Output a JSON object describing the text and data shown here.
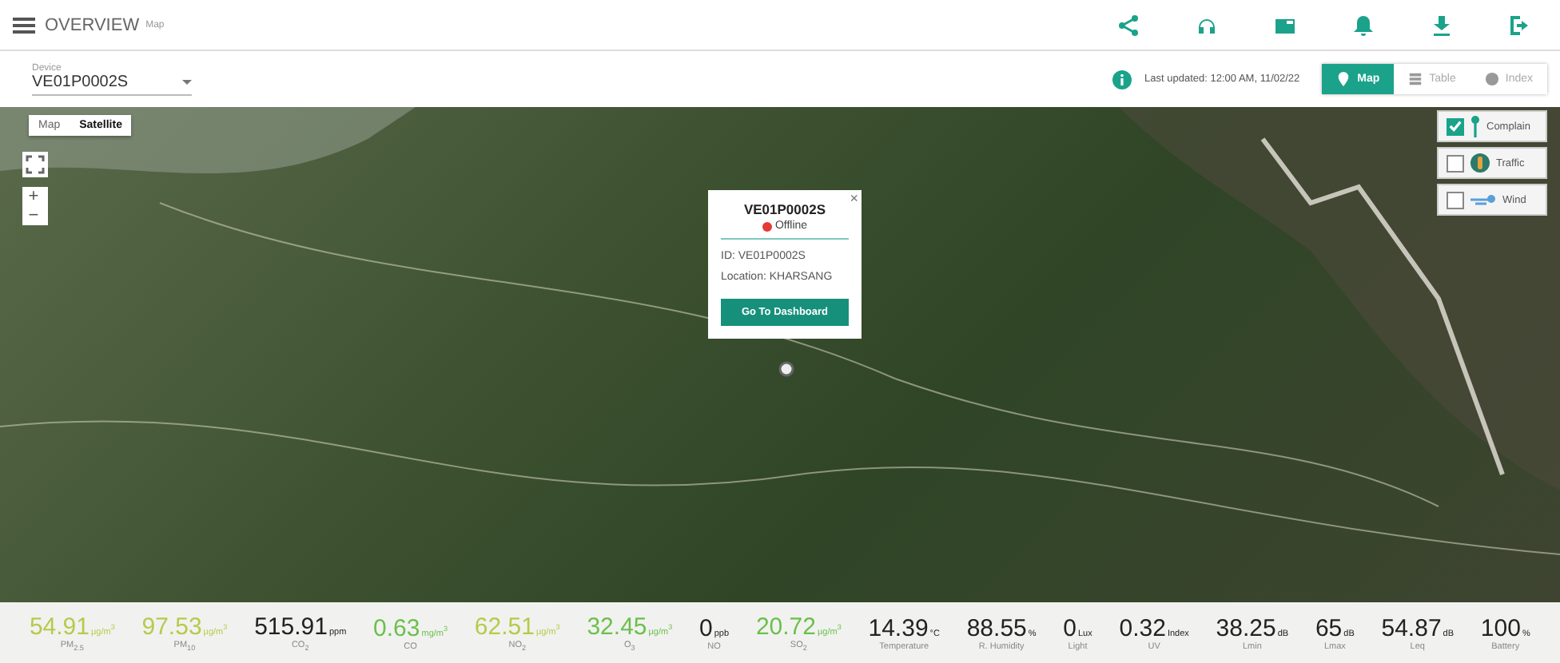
{
  "header": {
    "title": "OVERVIEW",
    "subtitle": "Map"
  },
  "device": {
    "label": "Device",
    "value": "VE01P0002S"
  },
  "status": {
    "last_updated": "Last updated: 12:00 AM, 11/02/22"
  },
  "views": [
    {
      "label": "Map",
      "selected": true
    },
    {
      "label": "Table",
      "selected": false
    },
    {
      "label": "Index",
      "selected": false
    }
  ],
  "map_types": [
    {
      "label": "Map",
      "selected": false
    },
    {
      "label": "Satellite",
      "selected": true
    }
  ],
  "zoom": {
    "in": "+",
    "out": "−"
  },
  "layers": [
    {
      "label": "Complain",
      "checked": true
    },
    {
      "label": "Traffic",
      "checked": false
    },
    {
      "label": "Wind",
      "checked": false
    }
  ],
  "popup": {
    "title": "VE01P0002S",
    "status": "Offline",
    "id": "ID: VE01P0002S",
    "location": "Location: KHARSANG",
    "button": "Go To Dashboard",
    "close": "×"
  },
  "readings": [
    {
      "value": "54.91",
      "unit": "µg/m$^{3}$",
      "label": "PM$_{2.5}$",
      "color": "#b8c94c"
    },
    {
      "value": "97.53",
      "unit": "µg/m$^{3}$",
      "label": "PM$_{10}$",
      "color": "#b8c94c"
    },
    {
      "value": "515.91",
      "unit": "ppm",
      "label": "CO$_{2}$",
      "color": "#222222"
    },
    {
      "value": "0.63",
      "unit": "mg/m$^{3}$",
      "label": "CO",
      "color": "#6cbf4e"
    },
    {
      "value": "62.51",
      "unit": "µg/m$^{3}$",
      "label": "NO$_{2}$",
      "color": "#b8c94c"
    },
    {
      "value": "32.45",
      "unit": "µg/m$^{3}$",
      "label": "O$_{3}$",
      "color": "#6cbf4e"
    },
    {
      "value": "0",
      "unit": "ppb",
      "label": "NO",
      "color": "#222222"
    },
    {
      "value": "20.72",
      "unit": "µg/m$^{3}$",
      "label": "SO$_{2}$",
      "color": "#6cbf4e"
    },
    {
      "value": "14.39",
      "unit": "°C",
      "label": "Temperature",
      "color": "#222222"
    },
    {
      "value": "88.55",
      "unit": "%",
      "label": "R. Humidity",
      "color": "#222222"
    },
    {
      "value": "0",
      "unit": "Lux",
      "label": "Light",
      "color": "#222222"
    },
    {
      "value": "0.32",
      "unit": "Index",
      "label": "UV",
      "color": "#222222"
    },
    {
      "value": "38.25",
      "unit": "dB",
      "label": "Lmin",
      "color": "#222222"
    },
    {
      "value": "65",
      "unit": "dB",
      "label": "Lmax",
      "color": "#222222"
    },
    {
      "value": "54.87",
      "unit": "dB",
      "label": "Leq",
      "color": "#222222"
    },
    {
      "value": "100",
      "unit": "%",
      "label": "Battery",
      "color": "#222222"
    }
  ]
}
